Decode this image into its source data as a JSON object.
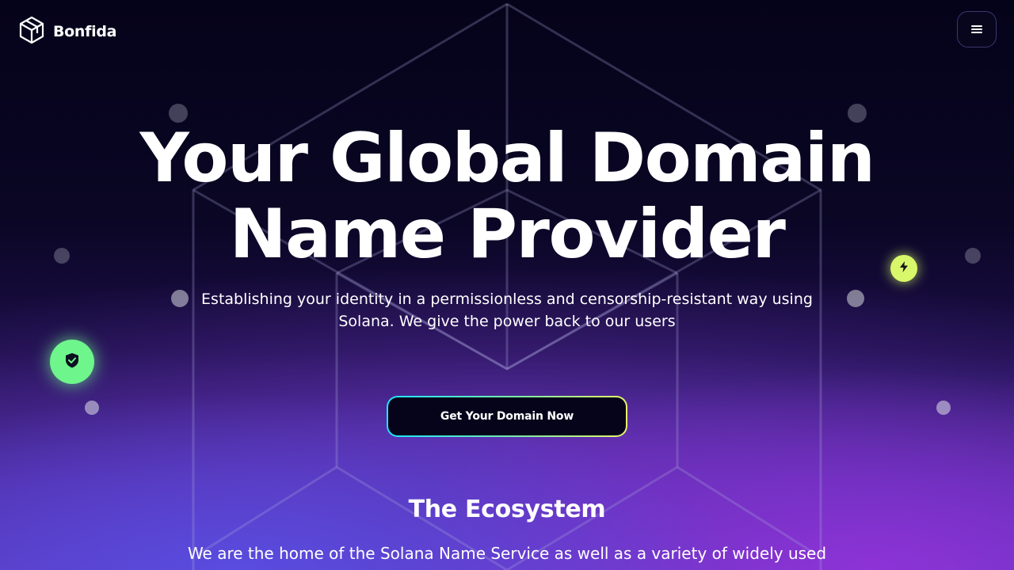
{
  "header": {
    "brand": "Bonfida",
    "menu_icon": "hamburger-icon"
  },
  "hero": {
    "title_line_1": "Your Global Domain",
    "title_line_2": "Name Provider",
    "subtitle": "Establishing your identity in a permissionless and censorship-resistant way using Solana. We give the power back to our users",
    "cta_label": "Get Your Domain Now"
  },
  "badges": {
    "left_icon": "shield-check-icon",
    "right_icon": "lightning-bolt-icon"
  },
  "ecosystem": {
    "title": "The Ecosystem",
    "text": "We are the home of the Solana Name Service as well as a variety of widely used"
  },
  "colors": {
    "background": "#05031a",
    "accent_green": "#6ef58c",
    "accent_lime": "#d9f76a",
    "cta_gradient_start": "#19e6ff",
    "cta_gradient_end": "#e8f56a"
  }
}
